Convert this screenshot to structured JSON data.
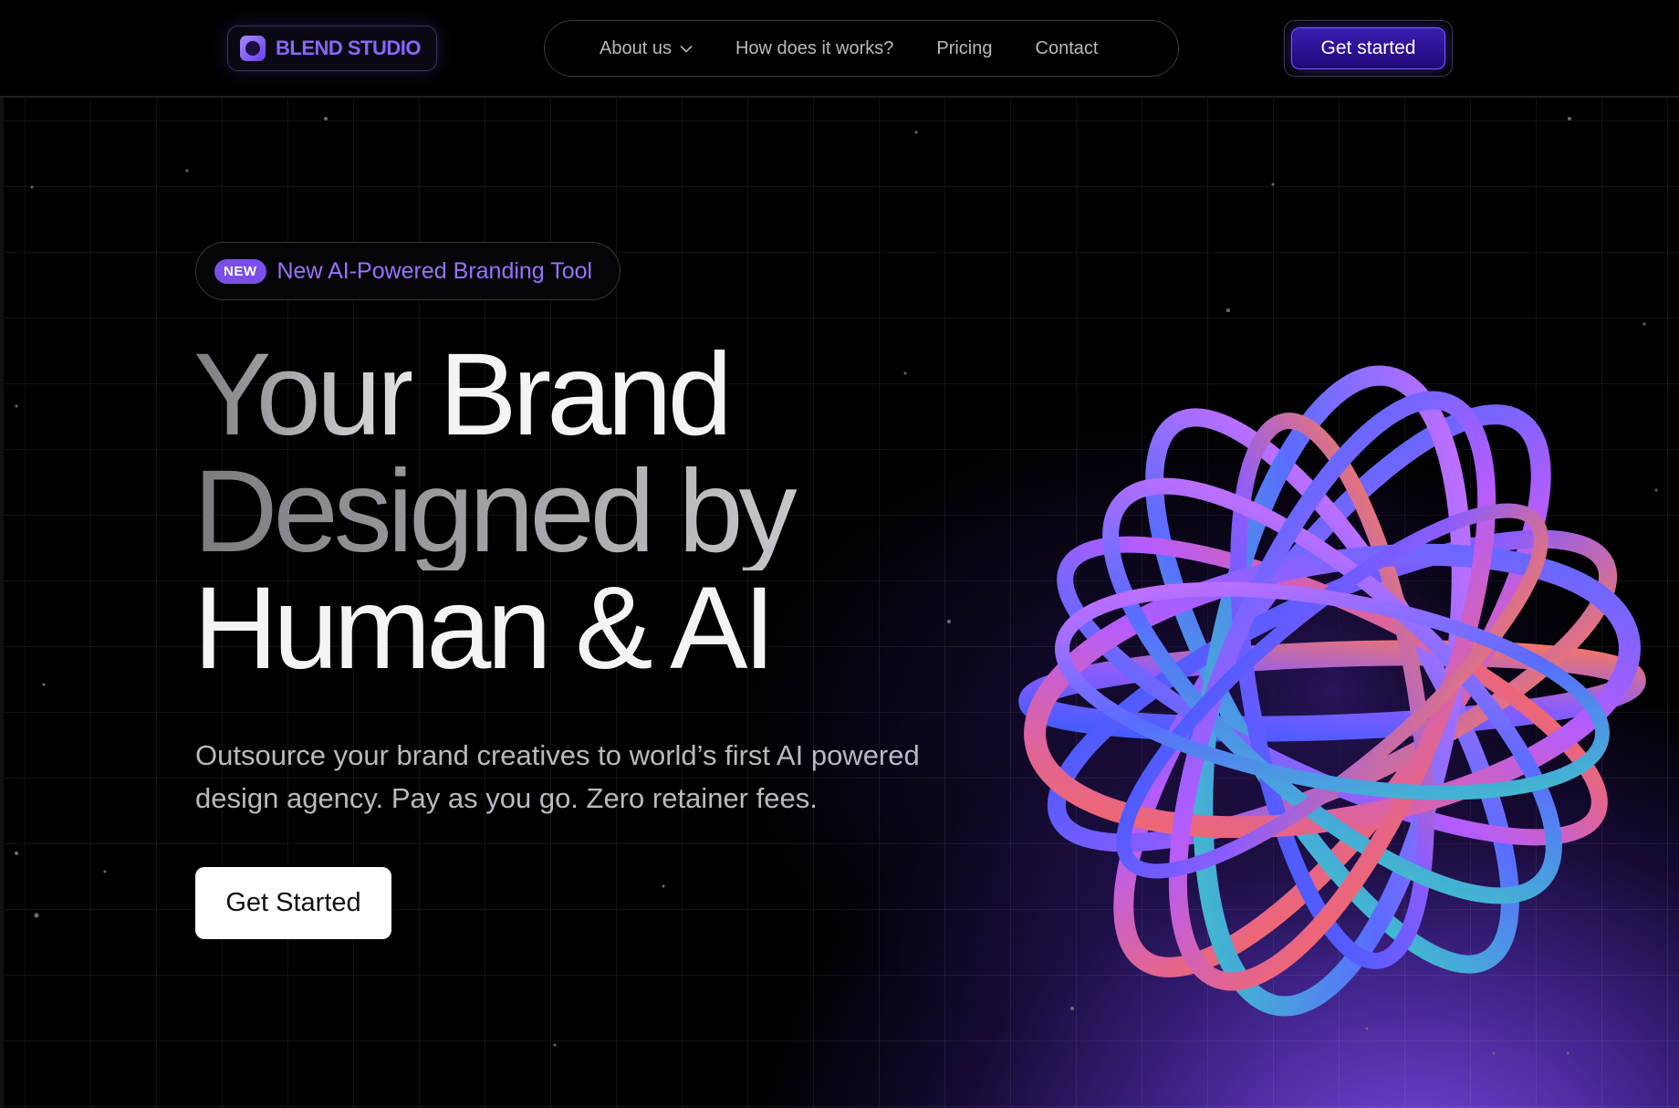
{
  "header": {
    "logo_text": "BLEND STUDIO",
    "nav": [
      {
        "label": "About us",
        "has_dropdown": true
      },
      {
        "label": "How does it works?"
      },
      {
        "label": "Pricing"
      },
      {
        "label": "Contact"
      }
    ],
    "cta_label": "Get started"
  },
  "hero": {
    "badge_tag": "NEW",
    "badge_text": "New AI-Powered Branding Tool",
    "headline": {
      "line1_a": "Your",
      "line1_b": "Brand",
      "line2_a": "Designed by",
      "line3": "Human & AI"
    },
    "subtitle": "Outsource your brand creatives to world’s first AI powered design agency. Pay as you go. Zero retainer fees.",
    "cta_label": "Get Started"
  },
  "colors": {
    "accent": "#7a4fe8",
    "background": "#000000",
    "glow": "#6b3fe0"
  },
  "icons": {
    "logo": "blend-logo-icon",
    "dropdown": "chevron-down-icon"
  }
}
